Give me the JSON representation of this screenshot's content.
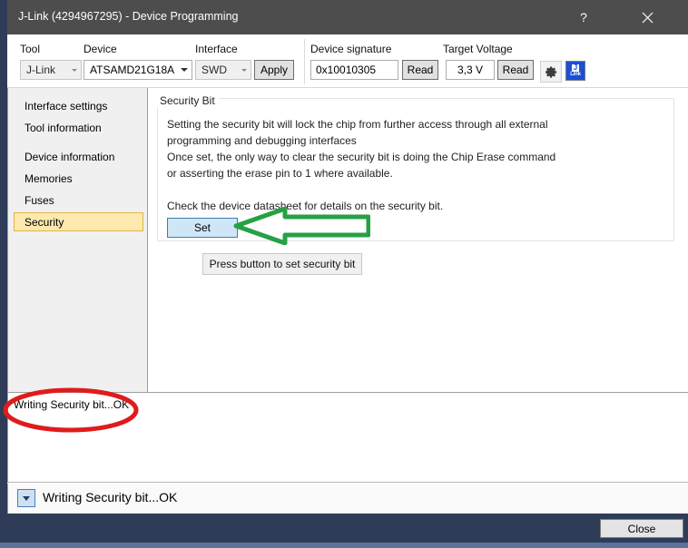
{
  "window": {
    "title": "J-Link (4294967295) - Device Programming",
    "help_label": "?",
    "close_label": "✕"
  },
  "toolbar": {
    "tool": {
      "label": "Tool",
      "value": "J-Link"
    },
    "device": {
      "label": "Device",
      "value": "ATSAMD21G18A"
    },
    "interface": {
      "label": "Interface",
      "value": "SWD"
    },
    "apply_label": "Apply",
    "device_signature": {
      "label": "Device signature",
      "value": "0x10010305",
      "read_label": "Read"
    },
    "target_voltage": {
      "label": "Target Voltage",
      "value": "3,3 V",
      "read_label": "Read"
    },
    "settings_icon": "gear-icon",
    "jlink_icon": {
      "top": "J",
      "bottom": "Link"
    }
  },
  "sidebar": {
    "items": [
      {
        "label": "Interface settings",
        "selected": false
      },
      {
        "label": "Tool information",
        "selected": false
      },
      {
        "label": "Device information",
        "selected": false
      },
      {
        "label": "Memories",
        "selected": false
      },
      {
        "label": "Fuses",
        "selected": false
      },
      {
        "label": "Security",
        "selected": true
      }
    ]
  },
  "content": {
    "groupbox_title": "Security Bit",
    "description_lines": [
      "Setting the security bit will lock the chip from further access through all external",
      "programming and debugging interfaces",
      "Once set, the only way to clear the security bit is doing the Chip Erase command",
      "or asserting the erase pin to 1 where available."
    ],
    "description_note": "Check the device datasheet for details on the security bit.",
    "set_button_label": "Set",
    "hint_label": "Press button to set security bit"
  },
  "log": {
    "lines": [
      "Writing Security bit...OK"
    ]
  },
  "status": {
    "text": "Writing Security bit...OK",
    "toggle_icon": "chevron-down-icon"
  },
  "footer": {
    "close_label": "Close"
  },
  "annotations": {
    "arrow_color": "#27a045",
    "ellipse_color": "#e01b1b"
  }
}
